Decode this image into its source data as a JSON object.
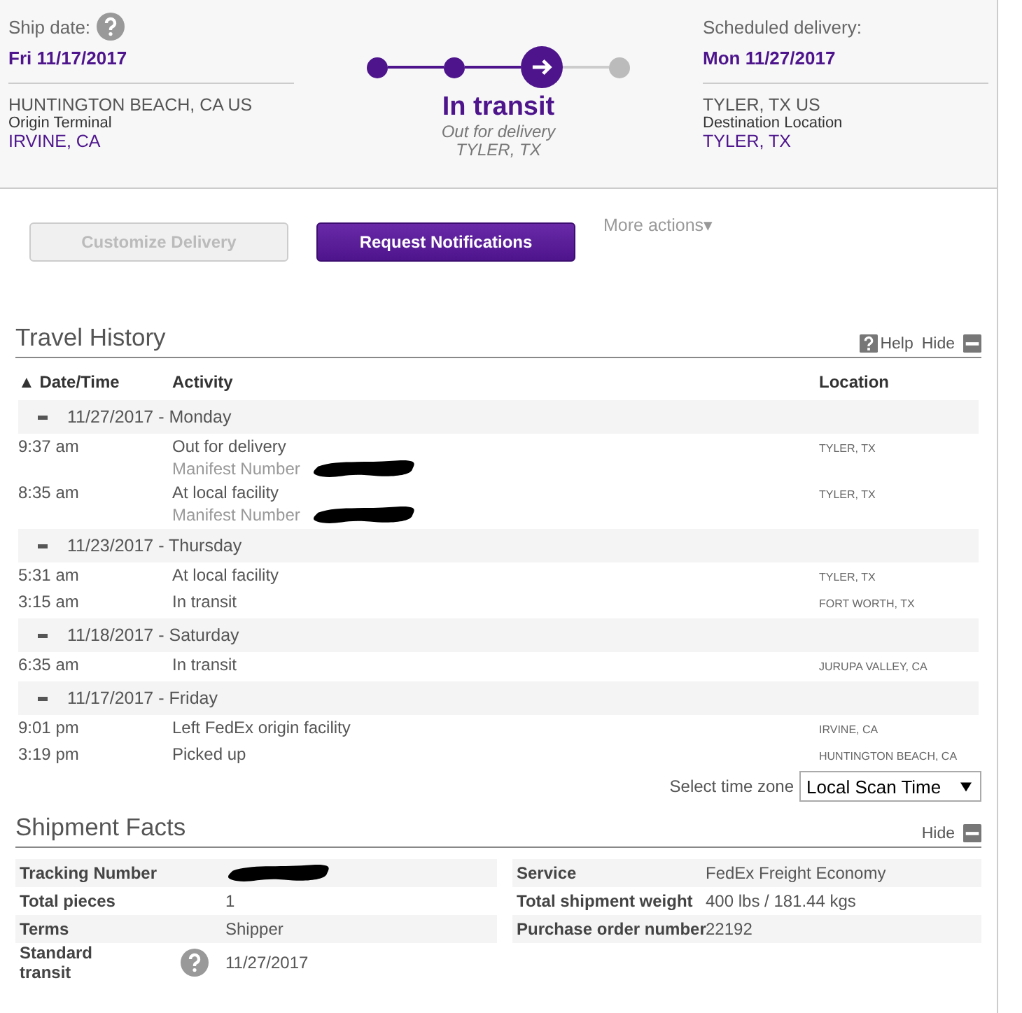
{
  "summary": {
    "ship_date_label": "Ship date:",
    "ship_date": "Fri 11/17/2017",
    "origin_city": "HUNTINGTON BEACH, CA US",
    "origin_label": "Origin Terminal",
    "origin_terminal": "IRVINE, CA",
    "status": "In transit",
    "status_detail": "Out for delivery",
    "status_location": "TYLER, TX",
    "steps": [
      {
        "kind": "done"
      },
      {
        "kind": "done"
      },
      {
        "kind": "current"
      },
      {
        "kind": "pending"
      }
    ],
    "delivery_label": "Scheduled delivery:",
    "delivery_date": "Mon 11/27/2017",
    "dest_city": "TYLER, TX US",
    "dest_label": "Destination Location",
    "dest_location": "TYLER, TX"
  },
  "actions": [
    {
      "label": "Customize Delivery",
      "disabled": true
    },
    {
      "label": "Request Notifications",
      "disabled": false
    }
  ],
  "more_actions": "More actions▾",
  "travel_history": {
    "title": "Travel History",
    "help": "Help",
    "hide": "Hide",
    "columns": [
      "▲ Date/Time",
      "Activity",
      "Location"
    ],
    "groups": [
      {
        "date": "11/27/2017 - Monday",
        "expanded": true,
        "events": [
          {
            "time": "9:37 am",
            "activity": "Out for delivery",
            "note": "Manifest Number",
            "redacted": true,
            "location": "TYLER, TX"
          },
          {
            "time": "8:35 am",
            "activity": "At local facility",
            "note": "Manifest Number",
            "redacted": true,
            "location": "TYLER, TX"
          }
        ]
      },
      {
        "date": "11/23/2017 - Thursday",
        "expanded": true,
        "events": [
          {
            "time": "5:31 am",
            "activity": "At local facility",
            "location": "TYLER, TX"
          },
          {
            "time": "3:15 am",
            "activity": "In transit",
            "location": "FORT WORTH, TX"
          }
        ]
      },
      {
        "date": "11/18/2017 - Saturday",
        "expanded": true,
        "events": [
          {
            "time": "6:35 am",
            "activity": "In transit",
            "location": "JURUPA VALLEY, CA"
          }
        ]
      },
      {
        "date": "11/17/2017 - Friday",
        "expanded": true,
        "events": [
          {
            "time": "9:01 pm",
            "activity": "Left FedEx origin facility",
            "location": "IRVINE, CA"
          },
          {
            "time": "3:19 pm",
            "activity": "Picked up",
            "location": "HUNTINGTON BEACH, CA"
          }
        ]
      }
    ],
    "timezone_label": "Select time zone",
    "timezone": "Local Scan Time"
  },
  "shipment_facts": {
    "title": "Shipment Facts",
    "hide": "Hide",
    "left": [
      {
        "label": "Tracking Number",
        "redacted": true
      },
      {
        "label": "Total pieces",
        "value": "1"
      },
      {
        "label": "Terms",
        "value": "Shipper"
      },
      {
        "label": "Standard transit",
        "value": "11/27/2017",
        "help": true
      }
    ],
    "right": [
      {
        "label": "Service",
        "value": "FedEx Freight Economy"
      },
      {
        "label": "Total shipment weight",
        "value": "400 lbs / 181.44 kgs"
      },
      {
        "label": "Purchase order number",
        "value": "22192"
      }
    ]
  }
}
